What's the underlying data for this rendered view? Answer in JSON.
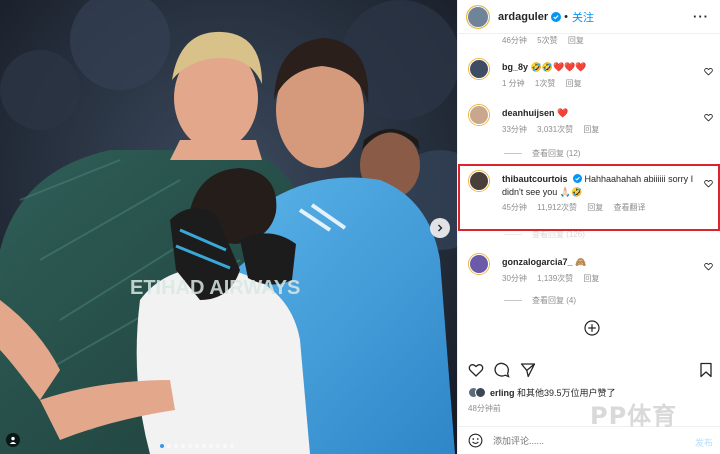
{
  "header": {
    "username": "ardaguler",
    "follow_label": "关注",
    "dot": "•",
    "more_label": "···"
  },
  "comments": {
    "top_partial_meta": [
      "46分钟",
      "5次赞",
      "回复"
    ],
    "items": [
      {
        "user": "bg_8y",
        "text": "🤣🤣❤️❤️❤️",
        "time": "1 分钟",
        "likes": "1次赞",
        "reply": "回复",
        "view_replies": "",
        "translate": ""
      },
      {
        "user": "deanhuijsen",
        "text": "❤️",
        "time": "33分钟",
        "likes": "3,031次赞",
        "reply": "回复",
        "view_replies": "查看回复 (12)",
        "translate": ""
      },
      {
        "user": "thibautcourtois",
        "text": "Hahhaahahah abiiiiii sorry I didn't see you 🙏🏻🤣",
        "time": "45分钟",
        "likes": "11,912次赞",
        "reply": "回复",
        "view_replies": "查看回复 (126)",
        "translate": "查看翻译"
      },
      {
        "user": "gonzalogarcia7_",
        "text": "🙈",
        "time": "30分钟",
        "likes": "1,139次赞",
        "reply": "回复",
        "view_replies": "查看回复 (4)",
        "translate": ""
      }
    ]
  },
  "likes_line": {
    "user": "erling",
    "text": "和其他39.5万位用户赞了"
  },
  "post_time": "48分钟前",
  "composer": {
    "placeholder": "添加评论......",
    "post_label": "发布"
  },
  "watermark": "PP体育",
  "photo": {
    "carousel_count": 11,
    "active_index": 0,
    "jersey_text": "ETIHAD AIRWAYS"
  },
  "colors": {
    "accent_blue": "#0095f6",
    "highlight_red": "#d9252b",
    "heart_red": "#ed4956",
    "muted_text": "#8e8e8e"
  }
}
